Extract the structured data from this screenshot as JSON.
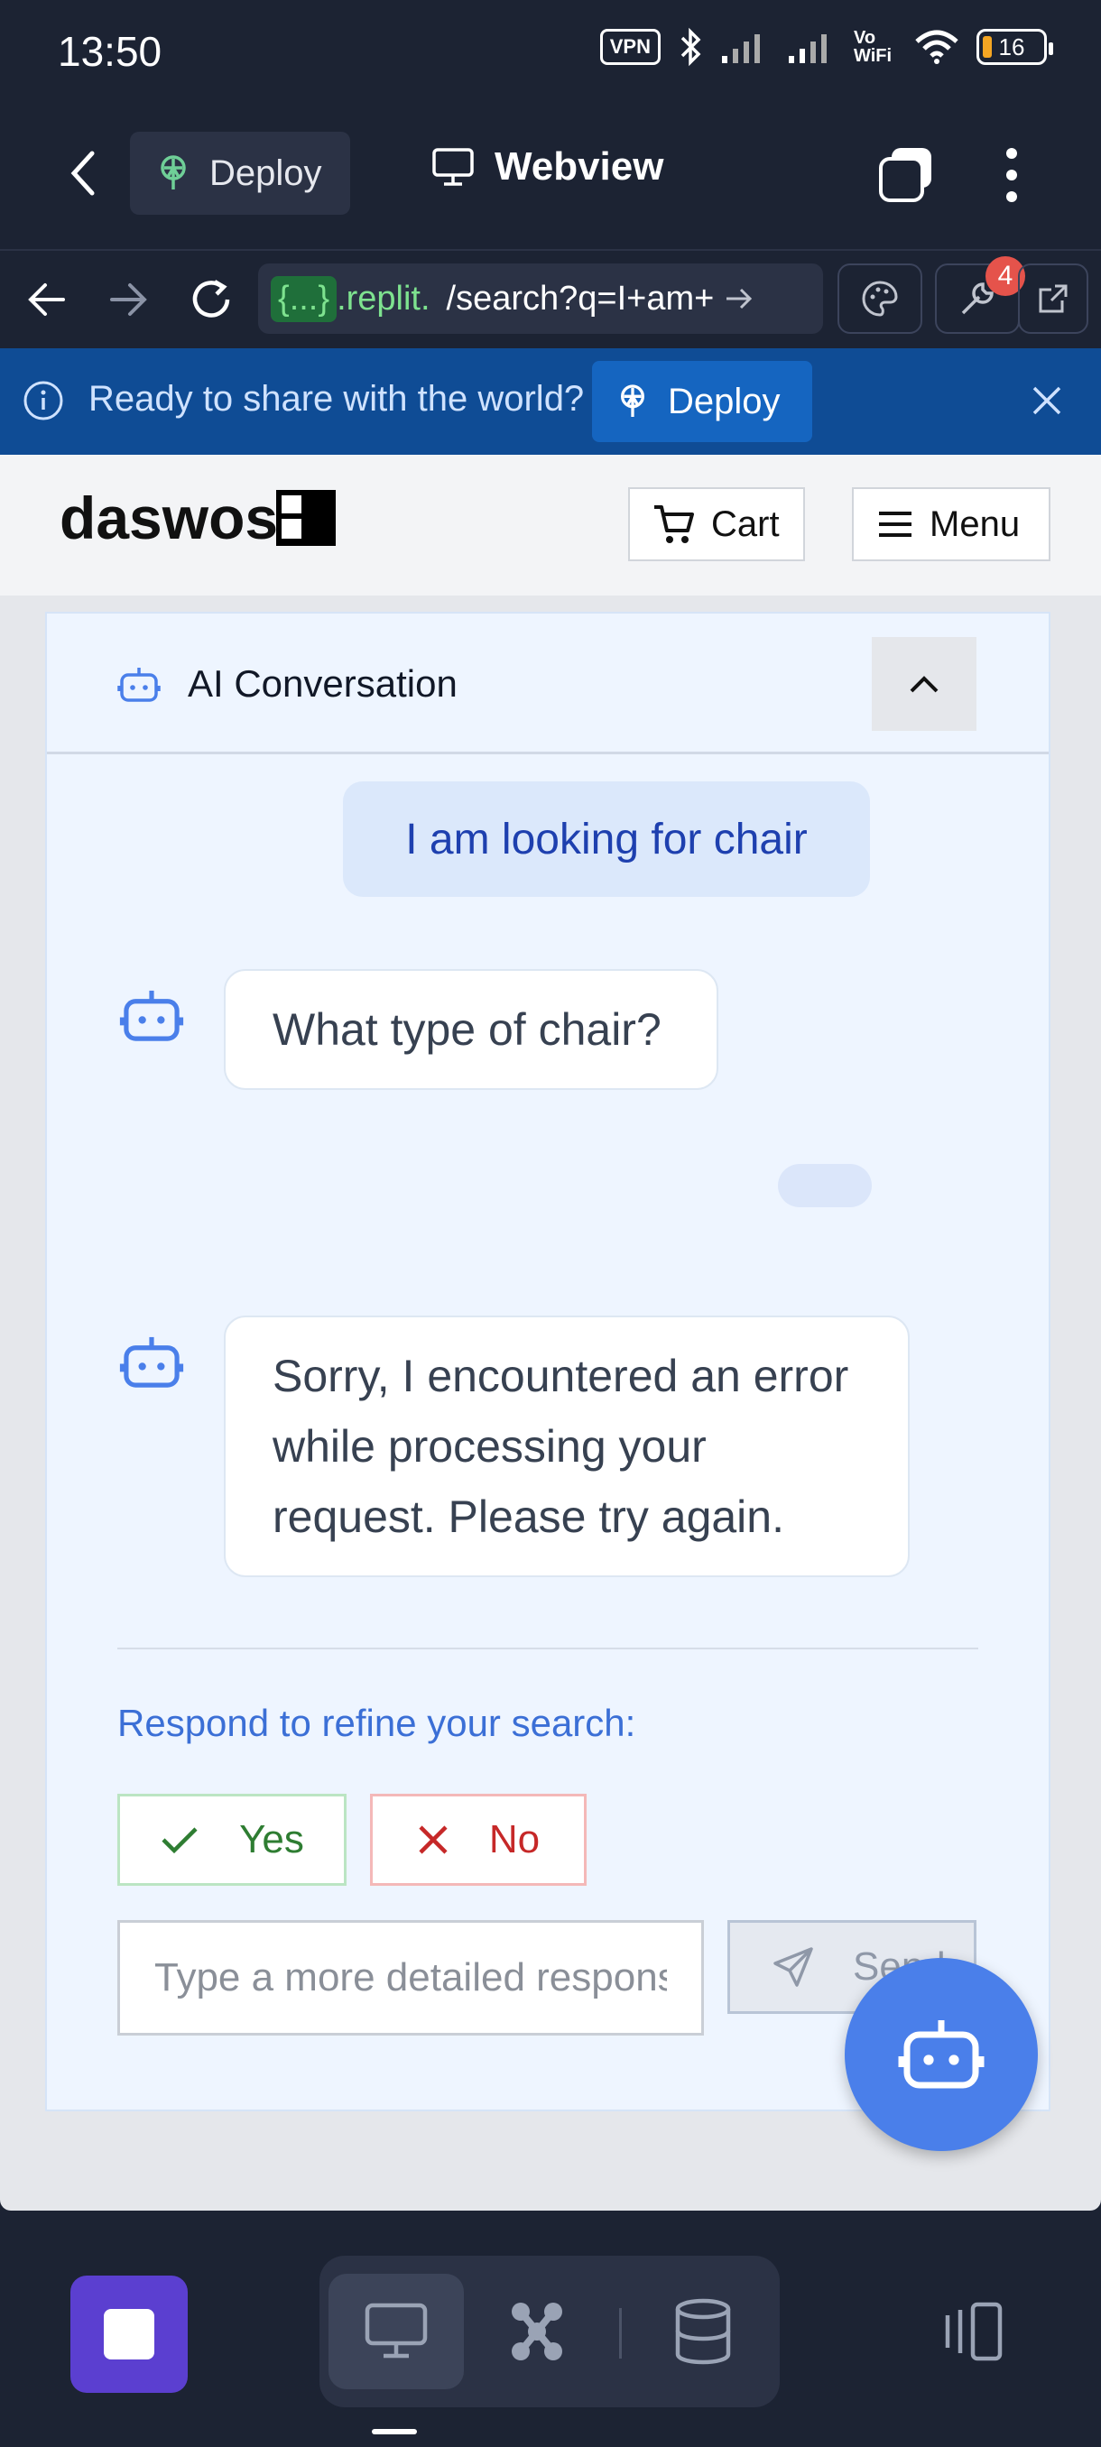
{
  "status_bar": {
    "time": "13:50",
    "vpn": "VPN",
    "wifi_label": "Vo WiFi",
    "battery": "16"
  },
  "appbar": {
    "deploy_label": "Deploy",
    "title": "Webview"
  },
  "urlbar": {
    "chip": "{...}",
    "host": ".replit.",
    "path": "/search?q=I+am+",
    "badge_count": "4"
  },
  "banner": {
    "text": "Ready to share with the world?",
    "deploy_label": "Deploy"
  },
  "site": {
    "logo_text": "daswos",
    "cart_label": "Cart",
    "menu_label": "Menu"
  },
  "chat": {
    "title": "AI Conversation",
    "messages": [
      {
        "role": "user",
        "text": "I am looking for chair"
      },
      {
        "role": "bot",
        "text": "What type of chair?"
      },
      {
        "role": "bot",
        "text": "Sorry, I encountered an error while processing your request. Please try again."
      }
    ],
    "refine_label": "Respond to refine your search:",
    "yes_label": "Yes",
    "no_label": "No",
    "input_placeholder": "Type a more detailed response",
    "send_label": "Send"
  },
  "colors": {
    "accent": "#4a7fea",
    "banner": "#0f4c95",
    "dark": "#1c2333",
    "stop": "#5b3fd0"
  }
}
